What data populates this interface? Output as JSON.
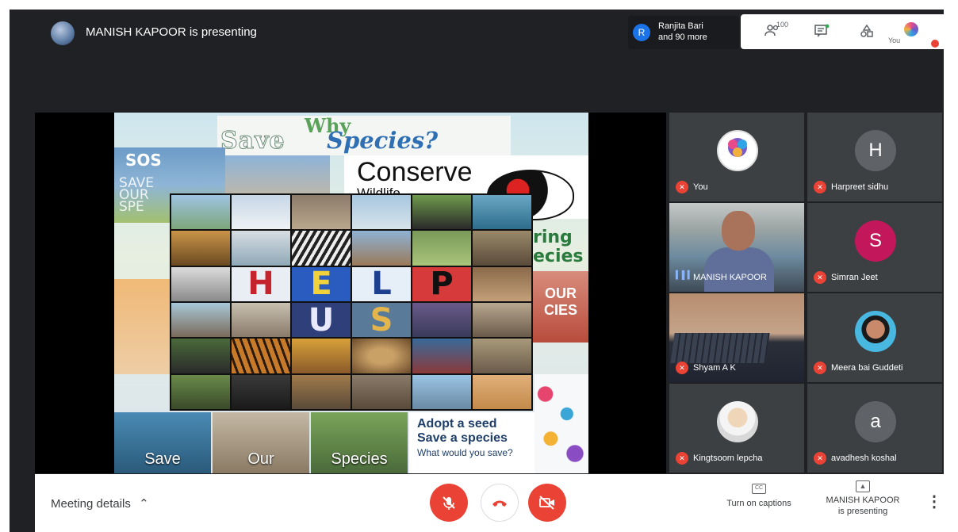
{
  "header": {
    "presenter_title": "MANISH KAPOOR is presenting",
    "people_initial": "R",
    "people_line1": "Ranjita Bari",
    "people_line2": "and 90 more",
    "participant_count": "100",
    "you_label": "You",
    "icons": [
      "people-icon",
      "chat-icon",
      "activities-icon"
    ]
  },
  "slide": {
    "title_save": "Save",
    "title_why": "Why",
    "title_species": "Species?",
    "sos": "SOS",
    "save_our": [
      "SAVE",
      "OUR",
      "SPE"
    ],
    "conserve": "Conserve",
    "wildlife": "Wildlife",
    "ring_cies": [
      "ring",
      "ecies"
    ],
    "our_spc": "OUR\nCIES",
    "help_letters": [
      "H",
      "E",
      "L",
      "P"
    ],
    "us_letters": [
      "U",
      "S"
    ],
    "bottom_labels": [
      "Save",
      "Our",
      "Species"
    ],
    "adopt_l1": "Adopt a seed",
    "adopt_l2": "Save a species",
    "adopt_l3": "What would you save?"
  },
  "participants": [
    {
      "name": "You",
      "avatar_type": "logo",
      "muted": true
    },
    {
      "name": "Harpreet sidhu",
      "avatar_letter": "H",
      "avatar_color": "#5f6368",
      "muted": true
    },
    {
      "name": "MANISH KAPOOR",
      "avatar_type": "video",
      "speaking": true
    },
    {
      "name": "Simran Jeet",
      "avatar_letter": "S",
      "avatar_color": "#c2185b",
      "muted": true
    },
    {
      "name": "Shyam A K",
      "avatar_type": "video",
      "muted": true
    },
    {
      "name": "Meera bai Guddeti",
      "avatar_type": "photo",
      "muted": true
    },
    {
      "name": "Kingtsoom lepcha",
      "avatar_type": "photo",
      "muted": true
    },
    {
      "name": "avadhesh koshal",
      "avatar_letter": "a",
      "avatar_color": "#5f6368",
      "muted": true
    }
  ],
  "bottom_bar": {
    "meeting_details": "Meeting details",
    "captions_icon": "CC",
    "captions_label": "Turn on captions",
    "present_line1": "MANISH KAPOOR",
    "present_line2": "is presenting",
    "accent_red": "#ea4335"
  }
}
